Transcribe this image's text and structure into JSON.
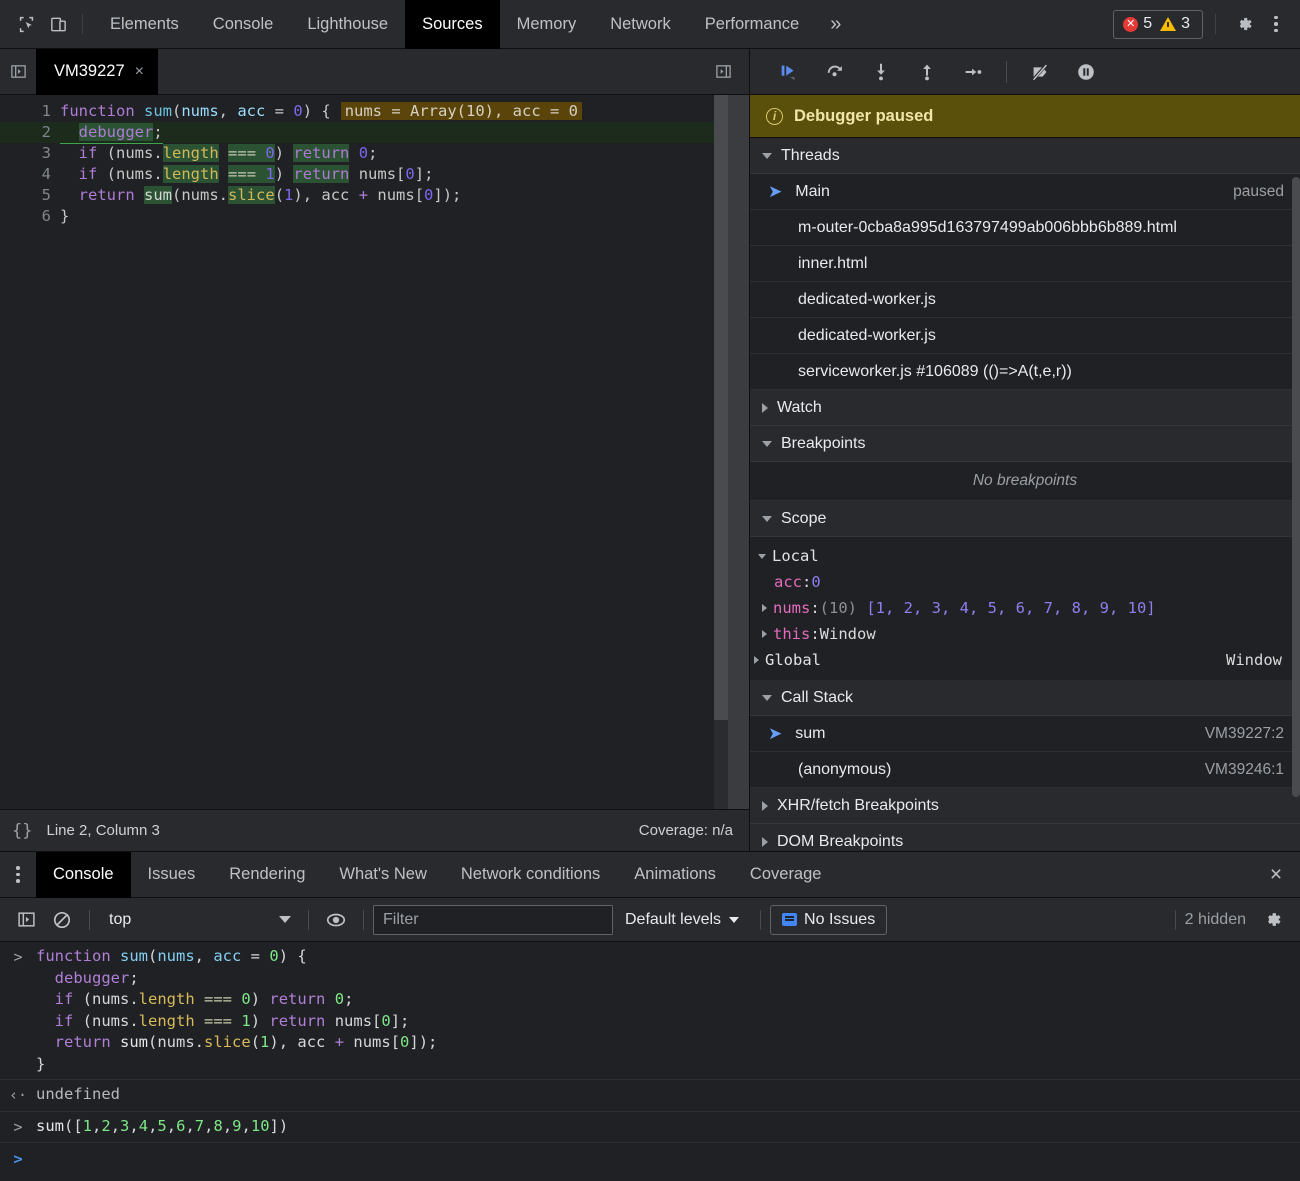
{
  "main_toolbar": {
    "inspect_icon": "inspect-cursor-icon",
    "device_icon": "device-toolbar-icon",
    "tabs": [
      {
        "label": "Elements",
        "active": false
      },
      {
        "label": "Console",
        "active": false
      },
      {
        "label": "Lighthouse",
        "active": false
      },
      {
        "label": "Sources",
        "active": true
      },
      {
        "label": "Memory",
        "active": false
      },
      {
        "label": "Network",
        "active": false
      },
      {
        "label": "Performance",
        "active": false
      }
    ],
    "more_tabs": "»",
    "error_count": "5",
    "warning_count": "3",
    "settings_icon": "gear-icon",
    "menu_icon": "kebab-menu-icon"
  },
  "editor": {
    "tab_name": "VM39227",
    "tab_close": "×",
    "nav_left_icon": "show-navigator-icon",
    "nav_right_icon": "show-debugger-icon",
    "lines": [
      {
        "n": "1"
      },
      {
        "n": "2"
      },
      {
        "n": "3"
      },
      {
        "n": "4"
      },
      {
        "n": "5"
      },
      {
        "n": "6"
      }
    ],
    "inline_hint": "nums = Array(10), acc = 0",
    "source_text": "function sum(nums, acc = 0) {\n  debugger;\n  if (nums.length === 0) return 0;\n  if (nums.length === 1) return nums[0];\n  return sum(nums.slice(1), acc + nums[0]);\n}"
  },
  "status_bar": {
    "braces_icon": "pretty-print-icon",
    "position": "Line 2, Column 3",
    "coverage": "Coverage: n/a"
  },
  "debug_toolbar": {
    "resume": "resume-script-icon",
    "step_over": "step-over-icon",
    "step_into": "step-into-icon",
    "step_out": "step-out-icon",
    "step": "step-icon",
    "deactivate_breakpoints": "deactivate-breakpoints-icon",
    "pause_on_exceptions": "pause-on-exceptions-icon"
  },
  "debugger_sidebar": {
    "paused_banner": "Debugger paused",
    "threads": {
      "title": "Threads",
      "expanded": true,
      "items": [
        {
          "label": "Main",
          "status": "paused",
          "selected": true
        },
        {
          "label": "m-outer-0cba8a995d163797499ab006bbb6b889.html",
          "status": "",
          "selected": false
        },
        {
          "label": "inner.html",
          "status": "",
          "selected": false
        },
        {
          "label": "dedicated-worker.js",
          "status": "",
          "selected": false
        },
        {
          "label": "dedicated-worker.js",
          "status": "",
          "selected": false
        },
        {
          "label": "serviceworker.js #106089 (()=>A(t,e,r))",
          "status": "",
          "selected": false
        }
      ]
    },
    "watch": {
      "title": "Watch",
      "expanded": false
    },
    "breakpoints": {
      "title": "Breakpoints",
      "expanded": true,
      "empty_text": "No breakpoints"
    },
    "scope": {
      "title": "Scope",
      "expanded": true,
      "local_label": "Local",
      "vars": [
        {
          "name": "acc",
          "sep": ": ",
          "value": "0",
          "value_kind": "num",
          "expandable": false
        },
        {
          "name": "nums",
          "sep": ": ",
          "count": "(10)",
          "value": "[1, 2, 3, 4, 5, 6, 7, 8, 9, 10]",
          "value_kind": "array",
          "expandable": true
        },
        {
          "name": "this",
          "sep": ": ",
          "value": "Window",
          "value_kind": "plain",
          "expandable": true
        }
      ],
      "global_label": "Global",
      "global_value": "Window"
    },
    "call_stack": {
      "title": "Call Stack",
      "expanded": true,
      "frames": [
        {
          "name": "sum",
          "location": "VM39227:2",
          "selected": true
        },
        {
          "name": "(anonymous)",
          "location": "VM39246:1",
          "selected": false
        }
      ]
    },
    "xhr_breakpoints": {
      "title": "XHR/fetch Breakpoints",
      "expanded": false
    },
    "dom_breakpoints": {
      "title": "DOM Breakpoints",
      "expanded": false
    }
  },
  "drawer": {
    "menu_icon": "kebab-menu-icon",
    "tabs": [
      {
        "label": "Console",
        "active": true
      },
      {
        "label": "Issues",
        "active": false
      },
      {
        "label": "Rendering",
        "active": false
      },
      {
        "label": "What's New",
        "active": false
      },
      {
        "label": "Network conditions",
        "active": false
      },
      {
        "label": "Animations",
        "active": false
      },
      {
        "label": "Coverage",
        "active": false
      }
    ],
    "close_label": "×"
  },
  "console_toolbar": {
    "sidebar_icon": "console-sidebar-icon",
    "clear_icon": "clear-console-icon",
    "context": "top",
    "eye_icon": "live-expression-icon",
    "filter_placeholder": "Filter",
    "filter_value": "",
    "levels": "Default levels",
    "issues_label": "No Issues",
    "hidden_label": "2 hidden",
    "settings_icon": "gear-icon"
  },
  "console_messages": [
    {
      "gutter": ">",
      "kind": "input",
      "code": "function sum(nums, acc = 0) {\n  debugger;\n  if (nums.length === 0) return 0;\n  if (nums.length === 1) return nums[0];\n  return sum(nums.slice(1), acc + nums[0]);\n}"
    },
    {
      "gutter": "‹·",
      "kind": "output",
      "code": "undefined"
    },
    {
      "gutter": ">",
      "kind": "input",
      "code": "sum([1,2,3,4,5,6,7,8,9,10])"
    }
  ],
  "console_prompt": {
    "gutter": ">",
    "value": ""
  },
  "colors": {
    "background": "#202124",
    "toolbar": "#292a2d",
    "active_tab": "#000000",
    "accent_blue": "#669df6",
    "paused_banner": "#5a4f0b",
    "error_red": "#e53935",
    "warning_yellow": "#fbbc04",
    "exec_line_green": "#1c2b1c"
  }
}
